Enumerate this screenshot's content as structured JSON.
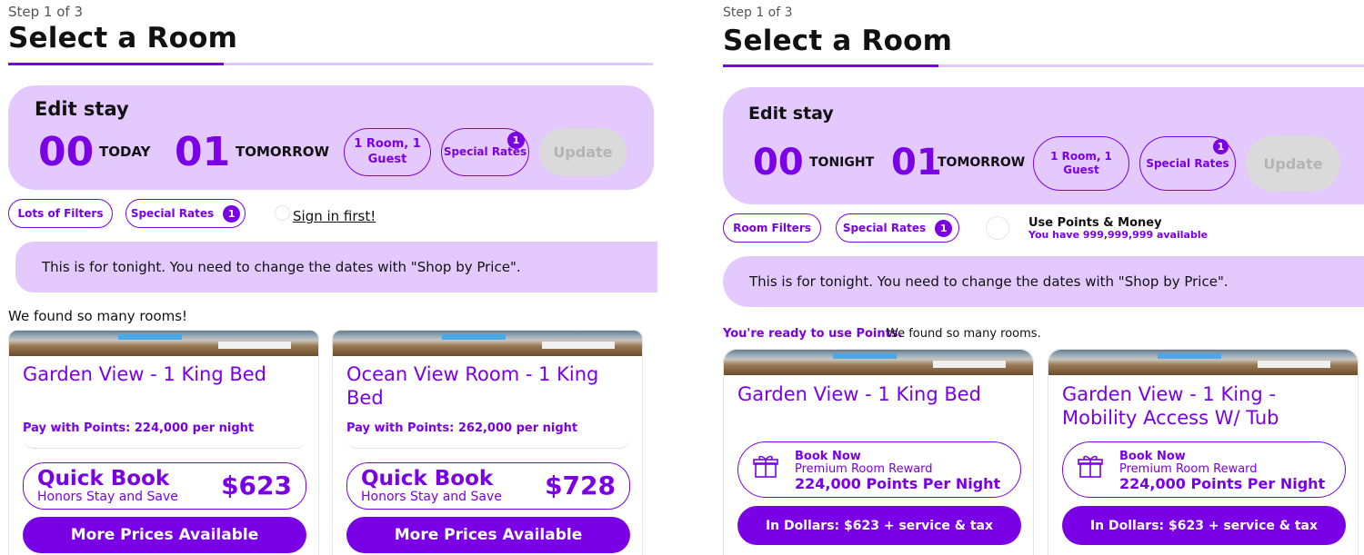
{
  "colors": {
    "accent": "#7a00e6",
    "panel_bg": "#e4c9ff",
    "disabled_bg": "#dadada",
    "disabled_text": "#b4b4b4"
  },
  "left": {
    "step": "Step 1 of 3",
    "title": "Select a Room",
    "edit": {
      "title": "Edit stay",
      "checkin_day": "00",
      "checkin_label": "TODAY",
      "checkout_day": "01",
      "checkout_label": "TOMORROW",
      "rooms_guests": "1 Room, 1 Guest",
      "special_rates": "Special Rates",
      "special_rates_count": "1",
      "update": "Update"
    },
    "filters": {
      "filters_label": "Lots of Filters",
      "special_rates_label": "Special Rates",
      "special_rates_count": "1",
      "signin_link": "Sign in first!"
    },
    "banner": "This is for tonight. You need to change the dates with \"Shop by Price\".",
    "found": "We found so many rooms!",
    "cards": [
      {
        "name": "Garden View - 1 King Bed",
        "points": "Pay with Points: 224,000 per night",
        "quick_title": "Quick Book",
        "quick_sub": "Honors Stay and Save",
        "price": "$623",
        "more": "More Prices Available"
      },
      {
        "name": "Ocean View Room - 1 King Bed",
        "points": "Pay with Points: 262,000 per night",
        "quick_title": "Quick Book",
        "quick_sub": "Honors Stay and Save",
        "price": "$728",
        "more": "More Prices Available"
      }
    ]
  },
  "right": {
    "step": "Step 1 of 3",
    "title": "Select a Room",
    "edit": {
      "title": "Edit stay",
      "checkin_day": "00",
      "checkin_label": "TONIGHT",
      "checkout_day": "01",
      "checkout_label": "TOMORROW",
      "rooms_guests": "1 Room, 1 Guest",
      "special_rates": "Special Rates",
      "special_rates_count": "1",
      "update": "Update"
    },
    "filters": {
      "filters_label": "Room Filters",
      "special_rates_label": "Special Rates",
      "special_rates_count": "1",
      "use_points_title": "Use Points & Money",
      "use_points_sub": "You have 999,999,999 available"
    },
    "banner": "This is for tonight. You need to change the dates with \"Shop by Price\".",
    "ready": "You're ready to use Points.",
    "found": "We found so many rooms.",
    "cards": [
      {
        "name": "Garden View - 1 King Bed",
        "reward_t1": "Book Now",
        "reward_t2": "Premium Room Reward",
        "reward_t3": "224,000 Points Per Night",
        "dollars": "In Dollars: $623 + service & tax"
      },
      {
        "name": "Garden View - 1 King - Mobility Access W/ Tub",
        "reward_t1": "Book Now",
        "reward_t2": "Premium Room Reward",
        "reward_t3": "224,000 Points Per Night",
        "dollars": "In Dollars: $623 + service & tax"
      }
    ]
  },
  "icons": {
    "gift": "gift-icon",
    "room_photo": "room-photo"
  }
}
